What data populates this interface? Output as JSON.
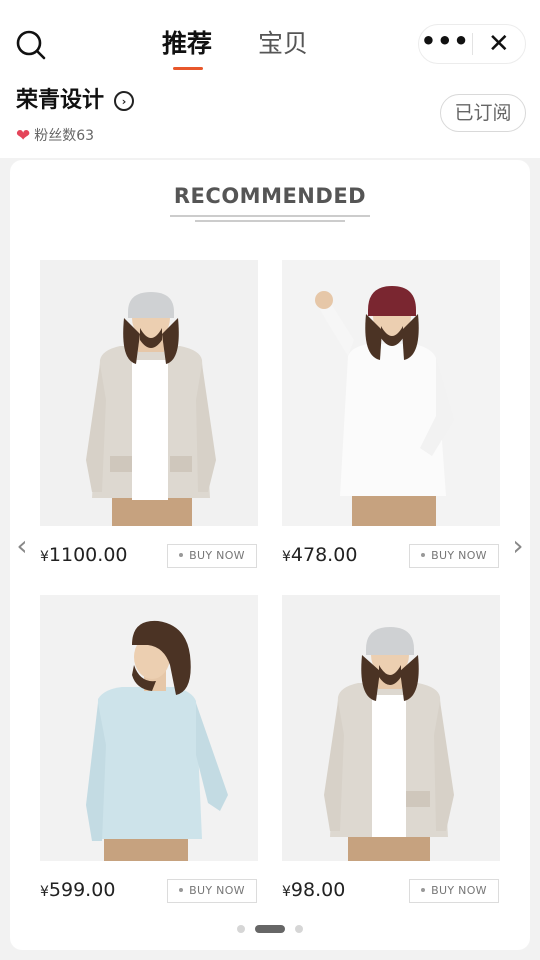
{
  "header": {
    "tabs": [
      {
        "label": "推荐",
        "active": true
      },
      {
        "label": "宝贝",
        "active": false
      }
    ],
    "search_icon": "search-icon",
    "more_icon": "more-dots-icon",
    "more_label": "•••",
    "close_icon": "close-icon",
    "close_label": "✕"
  },
  "shop": {
    "name": "荣青设计",
    "arrow_icon": "chevron-right-circle-icon",
    "arrow_label": "›",
    "heart_icon": "heart-icon",
    "heart_label": "❤",
    "fans_label": "粉丝数63",
    "subscribe_label": "已订阅"
  },
  "banner": {
    "title": "RECOMMENDED"
  },
  "carousel": {
    "prev_icon": "chevron-left-icon",
    "prev_label": "‹",
    "next_icon": "chevron-right-icon",
    "next_label": "›",
    "page_count": 3,
    "active_page": 1
  },
  "products": [
    {
      "currency": "¥",
      "price": "1100.00",
      "buy_label": "BUY NOW",
      "outfit": "grey beanie, oatmeal cardigan, white tee, khaki pants"
    },
    {
      "currency": "¥",
      "price": "478.00",
      "buy_label": "BUY NOW",
      "outfit": "burgundy beanie, white shirt, khaki pants"
    },
    {
      "currency": "¥",
      "price": "599.00",
      "buy_label": "BUY NOW",
      "outfit": "light blue shirt, khaki pants"
    },
    {
      "currency": "¥",
      "price": "98.00",
      "buy_label": "BUY NOW",
      "outfit": "grey beanie, oatmeal cardigan, white tee, khaki pants"
    }
  ],
  "colors": {
    "accent": "#e8572b",
    "heart": "#e4455a",
    "page_bg": "#f2f2f2"
  }
}
